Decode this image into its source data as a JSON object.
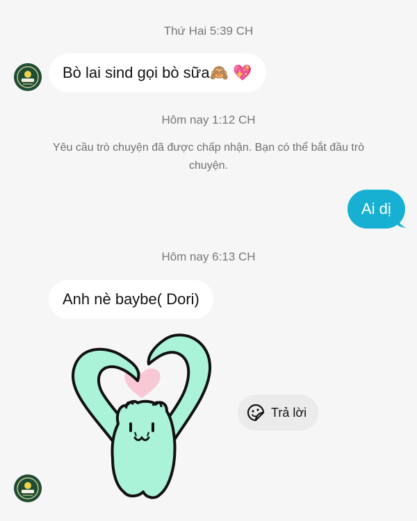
{
  "thread": {
    "ts1": "Thứ Hai 5:39 CH",
    "ts2": "Hôm nay 1:12 CH",
    "ts3": "Hôm nay 6:13 CH",
    "system_message": "Yêu cầu trò chuyện đã được chấp nhận. Bạn có thể bắt đầu trò chuyện.",
    "msg1_text": "Bò lai sind gọi bò sữa",
    "msg1_emoji1": "🙈",
    "msg1_emoji2": "💖",
    "msg2_text": "Ai dị",
    "msg3_text": "Anh nè baybe( Dori)",
    "sticker": "heart-cat-sticker"
  },
  "actions": {
    "reply_label": "Trả lời",
    "reply_icon": "sticker-smile-icon"
  },
  "colors": {
    "background": "#f6f6f6",
    "incoming_bubble": "#ffffff",
    "outgoing_bubble": "#17b0d2",
    "sticker_body": "#aaf2d8",
    "sticker_heart": "#f8c8d4"
  }
}
